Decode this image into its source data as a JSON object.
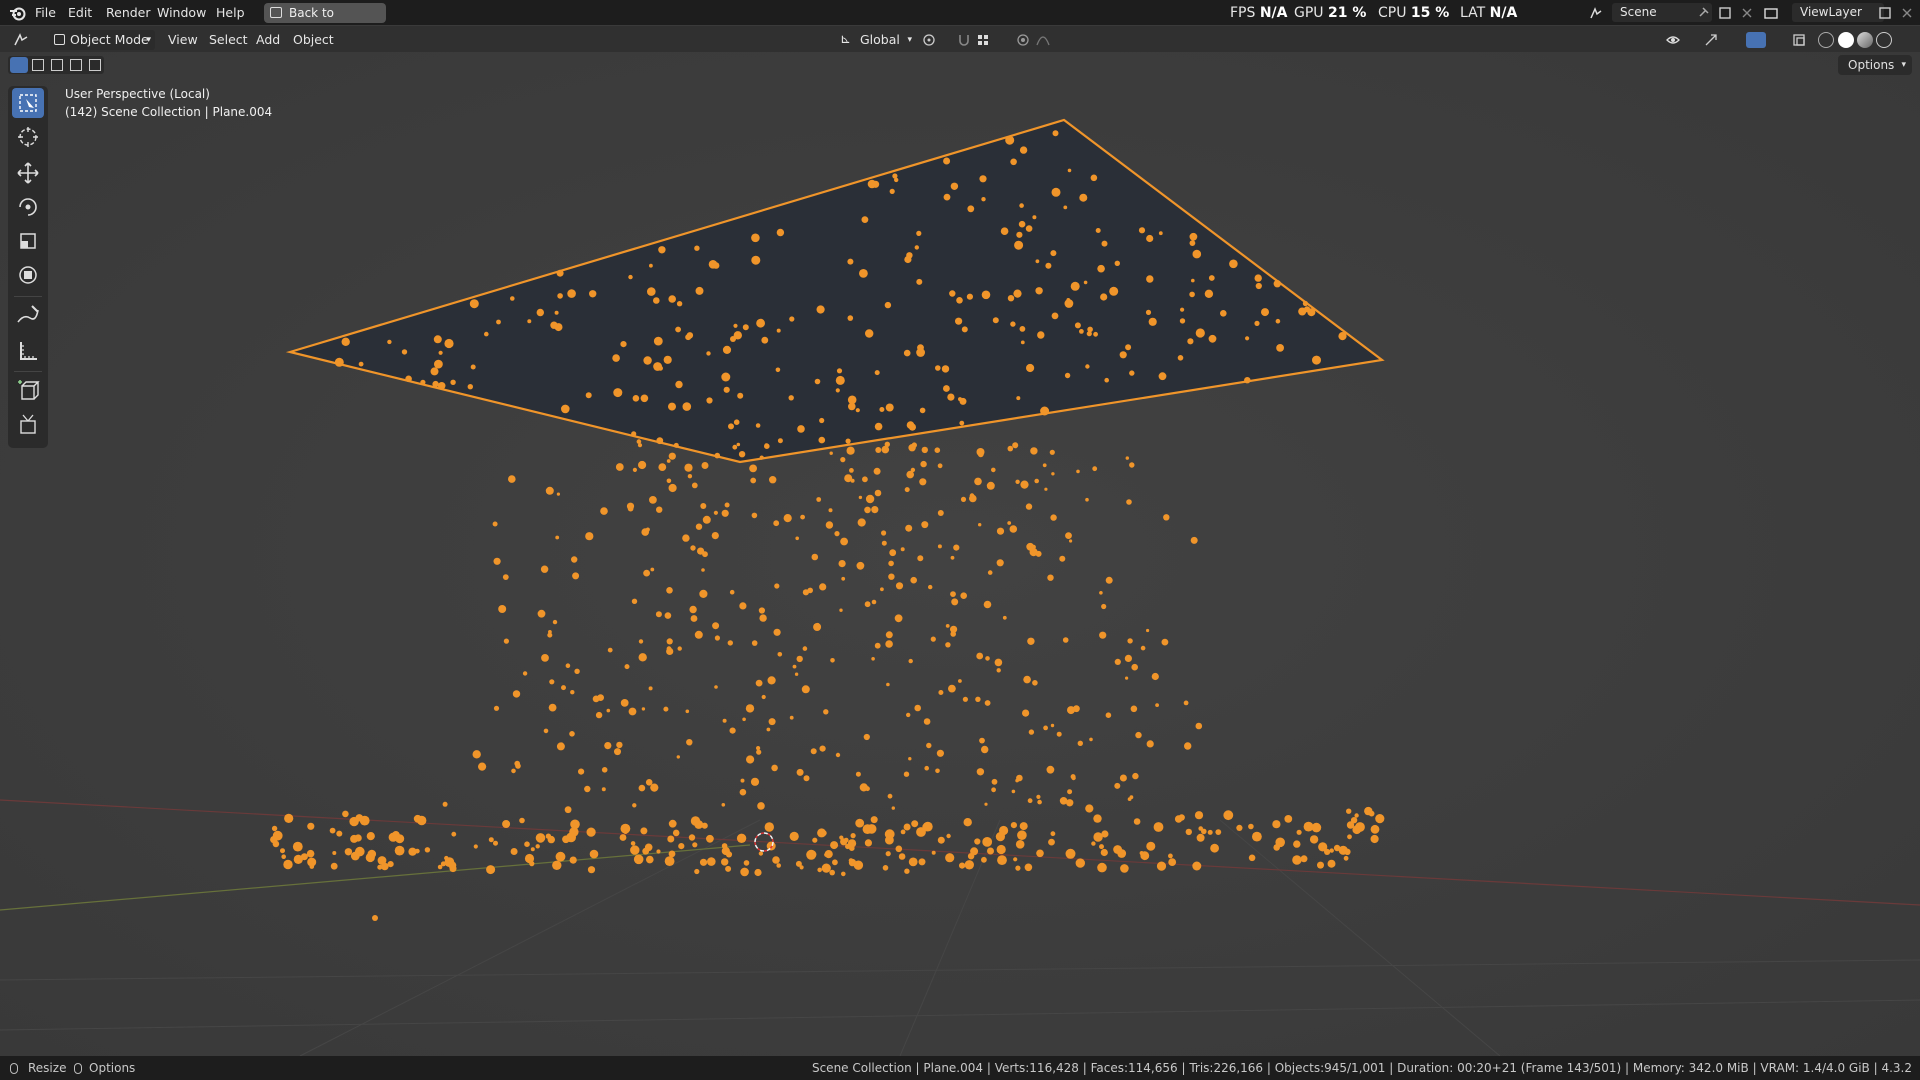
{
  "menu": [
    "File",
    "Edit",
    "Render",
    "Window",
    "Help"
  ],
  "back_button": "Back to Previous",
  "hud": {
    "fps_label": "FPS",
    "fps": "N/A",
    "gpu_label": "GPU",
    "gpu": "21 %",
    "cpu_label": "CPU",
    "cpu": "15 %",
    "lat_label": "LAT",
    "lat": "N/A"
  },
  "scene": "Scene",
  "view_layer": "ViewLayer",
  "header": {
    "mode": "Object Mode",
    "view": "View",
    "select": "Select",
    "add": "Add",
    "object": "Object",
    "transform": "Global",
    "options": "Options"
  },
  "viewport": {
    "perspective": "User Perspective (Local)",
    "collection": "(142) Scene Collection | Plane.004"
  },
  "status": {
    "resize": "Resize",
    "options": "Options",
    "info": "Scene Collection | Plane.004 | Verts:116,428 | Faces:114,656 | Tris:226,166 | Objects:945/1,001 | Duration: 00:20+21 (Frame 143/501) | Memory: 342.0 MiB | VRAM: 1.4/4.0 GiB | 4.3.2"
  },
  "colors": {
    "selection": "#f0952a",
    "plane_fill": "#2a2f37",
    "active_tool": "#4772b3"
  },
  "icons": [
    "blender-logo-icon",
    "select-box-icon",
    "cursor-icon",
    "move-icon",
    "rotate-icon",
    "scale-icon",
    "transform-icon",
    "annotate-icon",
    "measure-icon",
    "add-cube-icon",
    "add-object-icon"
  ]
}
